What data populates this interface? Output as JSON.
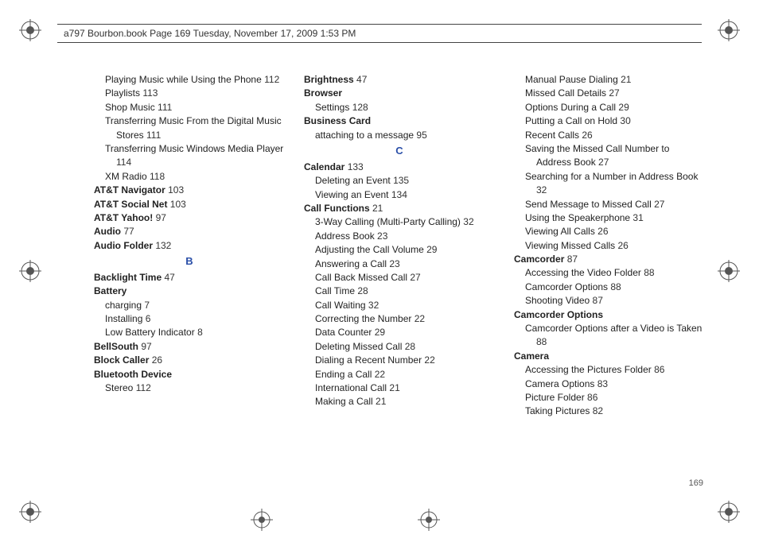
{
  "header": {
    "text": "a797 Bourbon.book  Page 169  Tuesday, November 17, 2009  1:53 PM"
  },
  "page_number": "169",
  "columns": {
    "col1": [
      {
        "t": "entry",
        "level": 1,
        "label": "Playing Music while Using the Phone",
        "page": "112"
      },
      {
        "t": "entry",
        "level": 1,
        "label": "Playlists",
        "page": "113"
      },
      {
        "t": "entry",
        "level": 1,
        "label": "Shop Music",
        "page": "111"
      },
      {
        "t": "entry",
        "level": 1,
        "label": "Transferring Music From the Digital Music Stores",
        "page": "111"
      },
      {
        "t": "entry",
        "level": 1,
        "label": "Transferring Music Windows Media Player",
        "page": "114"
      },
      {
        "t": "entry",
        "level": 1,
        "label": "XM Radio",
        "page": "118"
      },
      {
        "t": "entry",
        "level": 0,
        "bold": true,
        "label": "AT&T Navigator",
        "page": "103"
      },
      {
        "t": "entry",
        "level": 0,
        "bold": true,
        "label": "AT&T Social Net",
        "page": "103"
      },
      {
        "t": "entry",
        "level": 0,
        "bold": true,
        "label": "AT&T Yahoo!",
        "page": "97"
      },
      {
        "t": "entry",
        "level": 0,
        "bold": true,
        "label": "Audio",
        "page": "77"
      },
      {
        "t": "entry",
        "level": 0,
        "bold": true,
        "label": "Audio Folder",
        "page": "132"
      },
      {
        "t": "letter",
        "label": "B"
      },
      {
        "t": "entry",
        "level": 0,
        "bold": true,
        "label": "Backlight Time",
        "page": "47"
      },
      {
        "t": "entry",
        "level": 0,
        "bold": true,
        "label": "Battery",
        "page": ""
      },
      {
        "t": "entry",
        "level": 1,
        "label": "charging",
        "page": "7"
      },
      {
        "t": "entry",
        "level": 1,
        "label": "Installing",
        "page": "6"
      },
      {
        "t": "entry",
        "level": 1,
        "label": "Low Battery Indicator",
        "page": "8"
      },
      {
        "t": "entry",
        "level": 0,
        "bold": true,
        "label": "BellSouth",
        "page": "97"
      },
      {
        "t": "entry",
        "level": 0,
        "bold": true,
        "label": "Block Caller",
        "page": "26"
      },
      {
        "t": "entry",
        "level": 0,
        "bold": true,
        "label": "Bluetooth Device",
        "page": ""
      },
      {
        "t": "entry",
        "level": 1,
        "label": "Stereo",
        "page": "112"
      }
    ],
    "col2": [
      {
        "t": "entry",
        "level": 0,
        "bold": true,
        "label": "Brightness",
        "page": "47"
      },
      {
        "t": "entry",
        "level": 0,
        "bold": true,
        "label": "Browser",
        "page": ""
      },
      {
        "t": "entry",
        "level": 1,
        "label": "Settings",
        "page": "128"
      },
      {
        "t": "entry",
        "level": 0,
        "bold": true,
        "label": "Business Card",
        "page": ""
      },
      {
        "t": "entry",
        "level": 1,
        "label": "attaching to a message",
        "page": "95"
      },
      {
        "t": "letter",
        "label": "C"
      },
      {
        "t": "entry",
        "level": 0,
        "bold": true,
        "label": "Calendar",
        "page": "133"
      },
      {
        "t": "entry",
        "level": 1,
        "label": "Deleting an Event",
        "page": "135"
      },
      {
        "t": "entry",
        "level": 1,
        "label": "Viewing an Event",
        "page": "134"
      },
      {
        "t": "entry",
        "level": 0,
        "bold": true,
        "label": "Call Functions",
        "page": "21"
      },
      {
        "t": "entry",
        "level": 1,
        "label": "3-Way Calling (Multi-Party Calling)",
        "page": "32"
      },
      {
        "t": "entry",
        "level": 1,
        "label": "Address Book",
        "page": "23"
      },
      {
        "t": "entry",
        "level": 1,
        "label": "Adjusting the Call Volume",
        "page": "29"
      },
      {
        "t": "entry",
        "level": 1,
        "label": "Answering a Call",
        "page": "23"
      },
      {
        "t": "entry",
        "level": 1,
        "label": "Call Back Missed Call",
        "page": "27"
      },
      {
        "t": "entry",
        "level": 1,
        "label": "Call Time",
        "page": "28"
      },
      {
        "t": "entry",
        "level": 1,
        "label": "Call Waiting",
        "page": "32"
      },
      {
        "t": "entry",
        "level": 1,
        "label": "Correcting the Number",
        "page": "22"
      },
      {
        "t": "entry",
        "level": 1,
        "label": "Data Counter",
        "page": "29"
      },
      {
        "t": "entry",
        "level": 1,
        "label": "Deleting Missed Call",
        "page": "28"
      },
      {
        "t": "entry",
        "level": 1,
        "label": "Dialing a Recent Number",
        "page": "22"
      },
      {
        "t": "entry",
        "level": 1,
        "label": "Ending a Call",
        "page": "22"
      },
      {
        "t": "entry",
        "level": 1,
        "label": "International Call",
        "page": "21"
      },
      {
        "t": "entry",
        "level": 1,
        "label": "Making a Call",
        "page": "21"
      }
    ],
    "col3": [
      {
        "t": "entry",
        "level": 1,
        "label": "Manual Pause Dialing",
        "page": "21"
      },
      {
        "t": "entry",
        "level": 1,
        "label": "Missed Call Details",
        "page": "27"
      },
      {
        "t": "entry",
        "level": 1,
        "label": "Options During a Call",
        "page": "29"
      },
      {
        "t": "entry",
        "level": 1,
        "label": "Putting a Call on Hold",
        "page": "30"
      },
      {
        "t": "entry",
        "level": 1,
        "label": "Recent Calls",
        "page": "26"
      },
      {
        "t": "entry",
        "level": 1,
        "label": "Saving the Missed Call Number to Address Book",
        "page": "27"
      },
      {
        "t": "entry",
        "level": 1,
        "label": "Searching for a Number in Address Book",
        "page": "32"
      },
      {
        "t": "entry",
        "level": 1,
        "label": "Send Message to Missed Call",
        "page": "27"
      },
      {
        "t": "entry",
        "level": 1,
        "label": "Using the Speakerphone",
        "page": "31"
      },
      {
        "t": "entry",
        "level": 1,
        "label": "Viewing All Calls",
        "page": "26"
      },
      {
        "t": "entry",
        "level": 1,
        "label": "Viewing Missed Calls",
        "page": "26"
      },
      {
        "t": "entry",
        "level": 0,
        "bold": true,
        "label": "Camcorder",
        "page": "87"
      },
      {
        "t": "entry",
        "level": 1,
        "label": "Accessing the Video Folder",
        "page": "88"
      },
      {
        "t": "entry",
        "level": 1,
        "label": "Camcorder Options",
        "page": "88"
      },
      {
        "t": "entry",
        "level": 1,
        "label": "Shooting Video",
        "page": "87"
      },
      {
        "t": "entry",
        "level": 0,
        "bold": true,
        "label": "Camcorder Options",
        "page": ""
      },
      {
        "t": "entry",
        "level": 1,
        "label": "Camcorder Options after a Video is Taken",
        "page": "88"
      },
      {
        "t": "entry",
        "level": 0,
        "bold": true,
        "label": "Camera",
        "page": ""
      },
      {
        "t": "entry",
        "level": 1,
        "label": "Accessing the Pictures Folder",
        "page": "86"
      },
      {
        "t": "entry",
        "level": 1,
        "label": "Camera Options",
        "page": "83"
      },
      {
        "t": "entry",
        "level": 1,
        "label": "Picture Folder",
        "page": "86"
      },
      {
        "t": "entry",
        "level": 1,
        "label": "Taking Pictures",
        "page": "82"
      }
    ]
  }
}
